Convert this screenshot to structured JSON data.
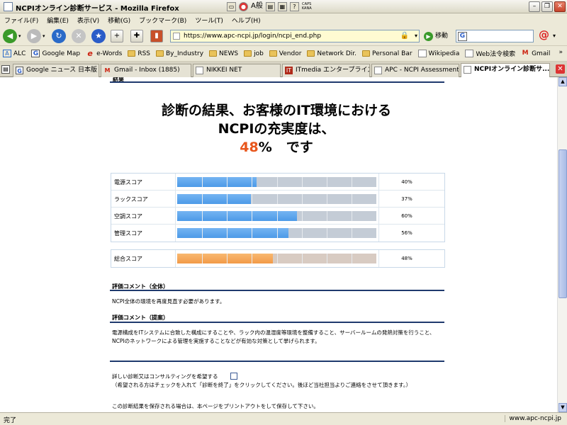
{
  "window": {
    "title": "NCPIオンライン診断サービス - Mozilla Firefox"
  },
  "menu": [
    "ファイル(F)",
    "編集(E)",
    "表示(V)",
    "移動(G)",
    "ブックマーク(B)",
    "ツール(T)",
    "ヘルプ(H)"
  ],
  "ime": {
    "mode": "A般",
    "caps": "CAPS",
    "kana": "KANA"
  },
  "nav": {
    "url": "https://www.apc-ncpi.jp/login/ncpi_end.php",
    "go_label": "移動",
    "search_value": ""
  },
  "bookmarks": [
    {
      "label": "ALC",
      "icon": "page-icon"
    },
    {
      "label": "Google Map",
      "icon": "google-icon"
    },
    {
      "label": "e-Words",
      "icon": "e-icon"
    },
    {
      "label": "RSS",
      "icon": "folder-icon"
    },
    {
      "label": "By_Industry",
      "icon": "folder-icon"
    },
    {
      "label": "NEWS",
      "icon": "folder-icon"
    },
    {
      "label": "job",
      "icon": "folder-icon"
    },
    {
      "label": "Vendor",
      "icon": "folder-icon"
    },
    {
      "label": "Network Dir.",
      "icon": "folder-icon"
    },
    {
      "label": "Personal Bar",
      "icon": "folder-icon"
    },
    {
      "label": "Wikipedia",
      "icon": "page-icon"
    },
    {
      "label": "Web法令検索",
      "icon": "page-icon"
    },
    {
      "label": "Gmail",
      "icon": "gmail-icon"
    }
  ],
  "tabs": [
    {
      "label": "Google ニュース 日本版",
      "icon": "google-icon",
      "active": false
    },
    {
      "label": "Gmail - Inbox (1885)",
      "icon": "gmail-icon",
      "active": false
    },
    {
      "label": "NIKKEI NET",
      "icon": "page-icon",
      "active": false
    },
    {
      "label": "ITmedia エンタープライズ:...",
      "icon": "itmedia-icon",
      "active": false
    },
    {
      "label": "APC - NCPI Assessment",
      "icon": "page-icon",
      "active": false
    },
    {
      "label": "NCPIオンライン診断サ...",
      "icon": "page-icon",
      "active": true
    }
  ],
  "page": {
    "top_cut_heading": "結果",
    "headline_line1": "診断の結果、お客様のIT環境における",
    "headline_line2": "NCPIの充実度は、",
    "headline_pct_num": "48",
    "headline_pct_sign": "%",
    "headline_suffix": "です",
    "scores": [
      {
        "label": "電源スコア",
        "value": "40%",
        "fraction": 0.4
      },
      {
        "label": "ラックスコア",
        "value": "37%",
        "fraction": 0.37
      },
      {
        "label": "空調スコア",
        "value": "60%",
        "fraction": 0.6
      },
      {
        "label": "管理スコア",
        "value": "56%",
        "fraction": 0.56
      }
    ],
    "total": {
      "label": "総合スコア",
      "value": "48%",
      "fraction": 0.48
    },
    "comment_overall_title": "評価コメント（全体）",
    "comment_overall_body": "NCPI全体の環境を再度見直す必要があります。",
    "comment_proposal_title": "評価コメント（提案）",
    "comment_proposal_body": "電源構成をITシステムに合致した構成にすることや、ラック内の温湿度等環境を整備すること、サーバールームの発熱対策を行うこと、NCPIのネットワークによる管理を実施することなどが有効な対策として挙げられます。",
    "consult_label": "詳しい診断又はコンサルティングを希望する",
    "consult_note": "（希望される方はチェックを入れて「診断を終了」をクリックしてください。後ほど当社担当よりご連絡をさせて頂きます。）",
    "print_note": "この診断結果を保存される場合は、本ページをプリントアウトをして保存して下さい。"
  },
  "status": {
    "left": "完了",
    "right": "www.apc-ncpi.jp"
  }
}
